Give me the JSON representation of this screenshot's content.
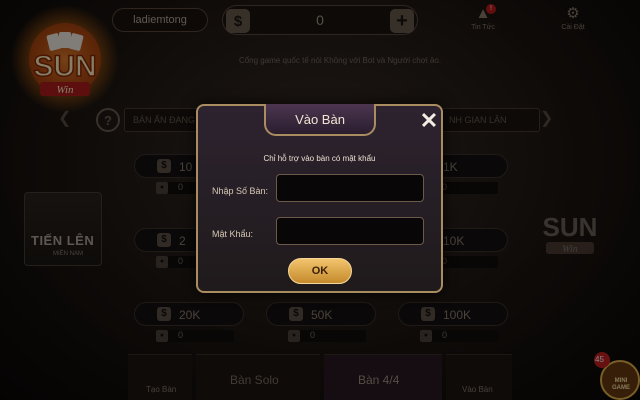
{
  "app": {
    "logo_text": "SUN",
    "logo_sub": "Win"
  },
  "topbar": {
    "username": "ladiemtong",
    "balance_symbol": "$",
    "balance": "0",
    "add_symbol": "+",
    "notifications_label": "Tin Tức",
    "notifications_badge": "!",
    "settings_label": "Cài Đặt"
  },
  "tagline": "Cổng game quốc tế nói Không với Bot và Người chơi ảo.",
  "filters": {
    "help_symbol": "?",
    "left_label": "BÀN ẤN ĐANG",
    "right_label": "NH GIAN LẬN"
  },
  "rooms": [
    {
      "bet": "10",
      "players": "0"
    },
    {
      "bet": "1K",
      "players": "0"
    },
    {
      "bet": "2",
      "players": "0"
    },
    {
      "bet": "10K",
      "players": "0"
    },
    {
      "bet": "20K",
      "players": "0"
    },
    {
      "bet": "50K",
      "players": "0"
    },
    {
      "bet": "100K",
      "players": "0"
    }
  ],
  "side_game": {
    "title": "TIẾN LÊN",
    "subtitle": "MIỀN NAM"
  },
  "bottom": {
    "create_table": "Tạo Bàn",
    "solo_tab": "Bàn Solo",
    "four_tab": "Bàn 4/4",
    "join_table": "Vào Bàn",
    "mini_game_count": "45",
    "mini_game_label": "MINI GAME"
  },
  "dialog": {
    "title": "Vào Bàn",
    "notice": "Chỉ hỗ trợ vào bàn có mật khẩu",
    "table_number_label": "Nhập Số Bàn:",
    "table_number_value": "",
    "password_label": "Mật Khẩu:",
    "password_value": "",
    "ok_label": "OK"
  },
  "colors": {
    "accent_gold": "#f3c46d",
    "dialog_border": "#a98c5f",
    "dialog_bg": "#2d2330"
  }
}
